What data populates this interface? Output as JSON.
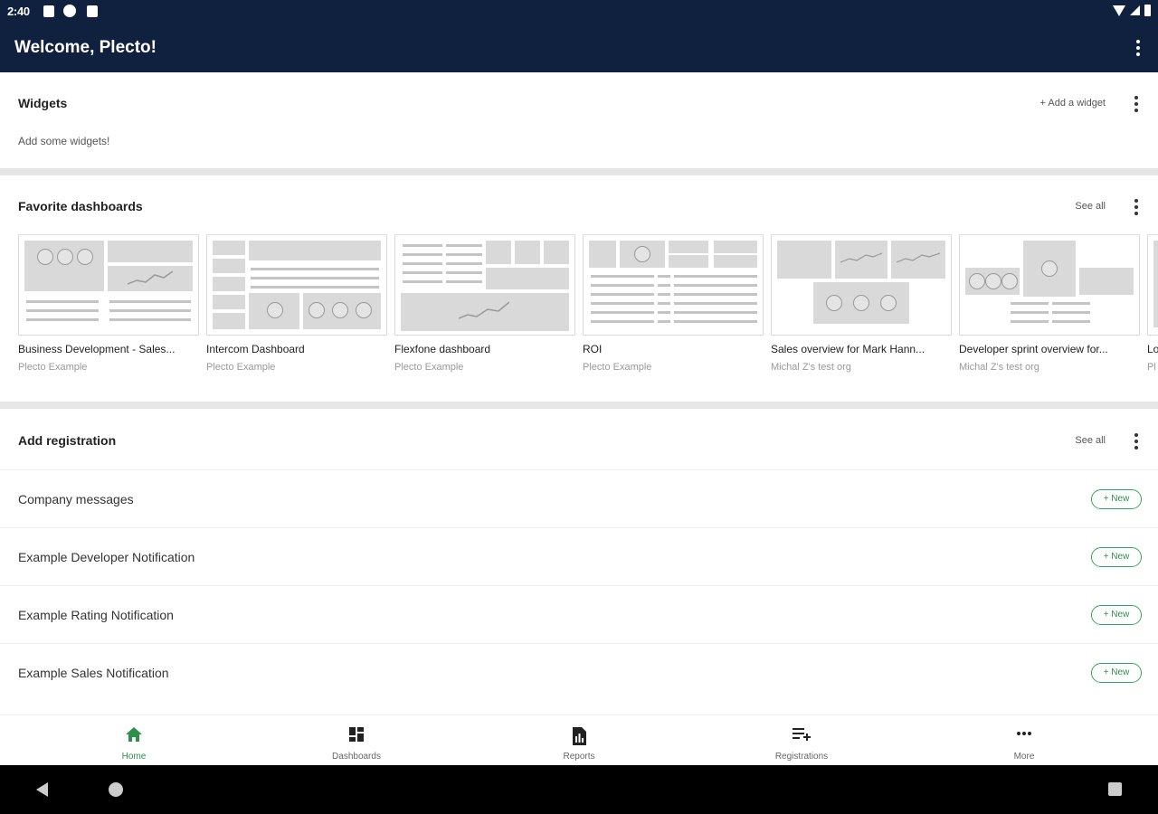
{
  "status": {
    "time": "2:40"
  },
  "app": {
    "title": "Welcome, Plecto!"
  },
  "widgets": {
    "title": "Widgets",
    "action": "+ Add a widget",
    "empty": "Add some widgets!"
  },
  "favorites": {
    "title": "Favorite dashboards",
    "action": "See all",
    "items": [
      {
        "name": "Business Development - Sales...",
        "org": "Plecto Example"
      },
      {
        "name": "Intercom Dashboard",
        "org": "Plecto Example"
      },
      {
        "name": "Flexfone dashboard",
        "org": "Plecto Example"
      },
      {
        "name": "ROI",
        "org": "Plecto Example"
      },
      {
        "name": "Sales overview for Mark Hann...",
        "org": "Michal Z's test org"
      },
      {
        "name": "Developer sprint overview for...",
        "org": "Michal Z's test org"
      },
      {
        "name": "Lo",
        "org": "Pl"
      }
    ]
  },
  "registration": {
    "title": "Add registration",
    "action": "See all",
    "new_label": "+ New",
    "rows": [
      {
        "label": "Company messages"
      },
      {
        "label": "Example Developer Notification"
      },
      {
        "label": "Example Rating Notification"
      },
      {
        "label": "Example Sales Notification"
      }
    ]
  },
  "nav": {
    "items": [
      {
        "label": "Home",
        "icon": "home-icon",
        "active": true
      },
      {
        "label": "Dashboards",
        "icon": "dashboards-icon"
      },
      {
        "label": "Reports",
        "icon": "reports-icon"
      },
      {
        "label": "Registrations",
        "icon": "registrations-icon"
      },
      {
        "label": "More",
        "icon": "more-icon"
      }
    ]
  },
  "colors": {
    "header": "#10213f",
    "accent": "#2e8f4c"
  }
}
